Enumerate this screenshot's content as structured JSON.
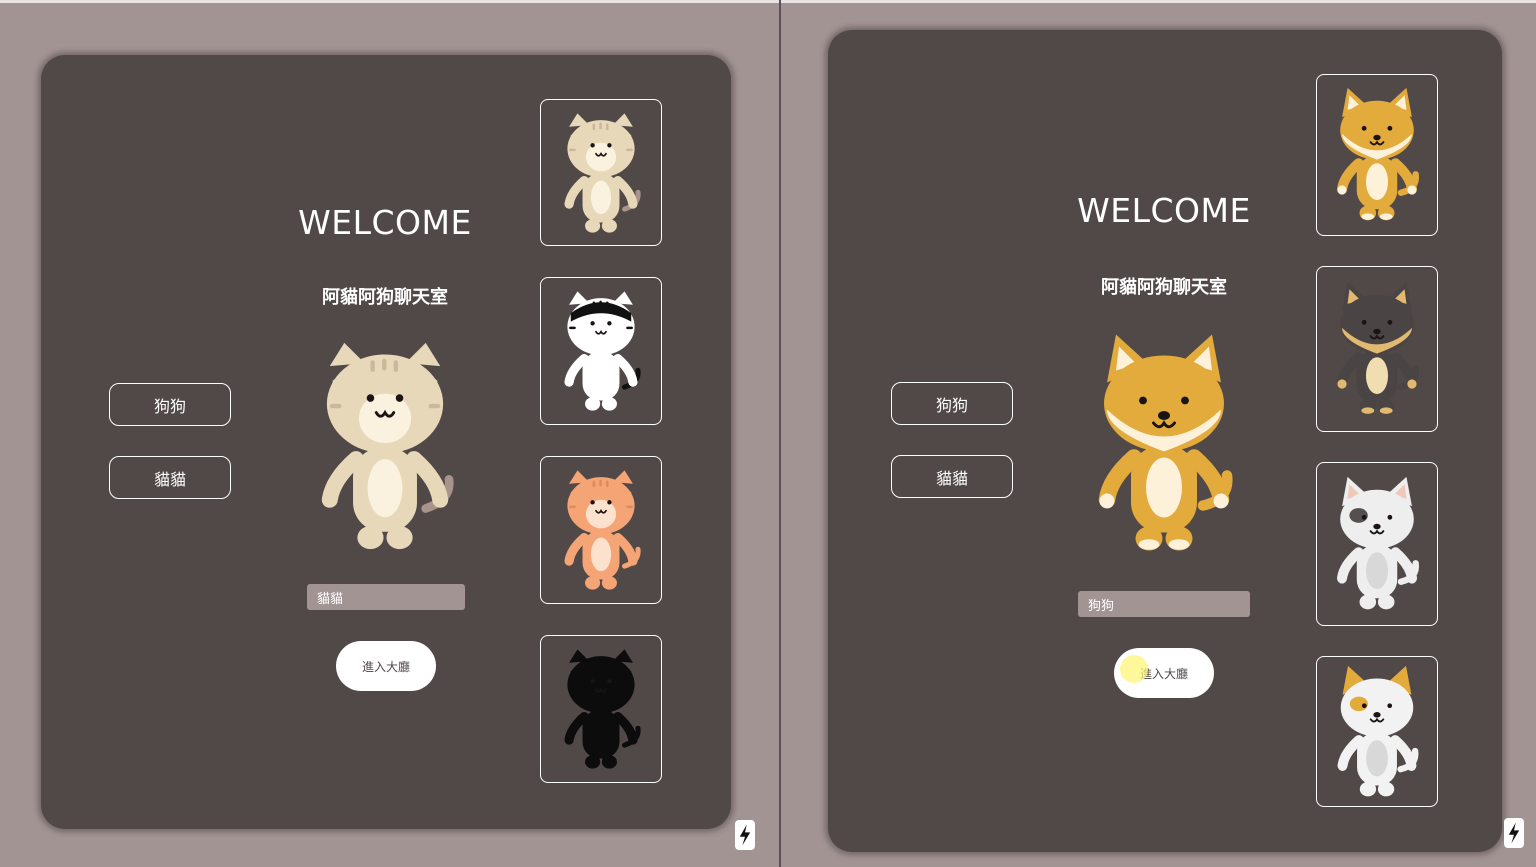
{
  "left": {
    "title": "WELCOME",
    "subtitle": "阿貓阿狗聊天室",
    "options": {
      "dog_label": "狗狗",
      "cat_label": "貓貓"
    },
    "input": {
      "value": "貓貓"
    },
    "enter_label": "進入大廳",
    "avatars": [
      "tabby-cat-icon",
      "tuxedo-cat-icon",
      "orange-cat-icon",
      "black-cat-icon"
    ],
    "selected_avatar": "tabby-cat-icon"
  },
  "right": {
    "title": "WELCOME",
    "subtitle": "阿貓阿狗聊天室",
    "options": {
      "dog_label": "狗狗",
      "cat_label": "貓貓"
    },
    "input": {
      "value": "狗狗"
    },
    "enter_label": "進入大廳",
    "avatars": [
      "shiba-dog-icon",
      "black-dog-icon",
      "spotted-dog-icon",
      "calico-dog-icon"
    ],
    "selected_avatar": "shiba-dog-icon"
  },
  "colors": {
    "background": "#a39494",
    "panel": "#514948",
    "input": "#a39494",
    "text": "#ffffff"
  }
}
